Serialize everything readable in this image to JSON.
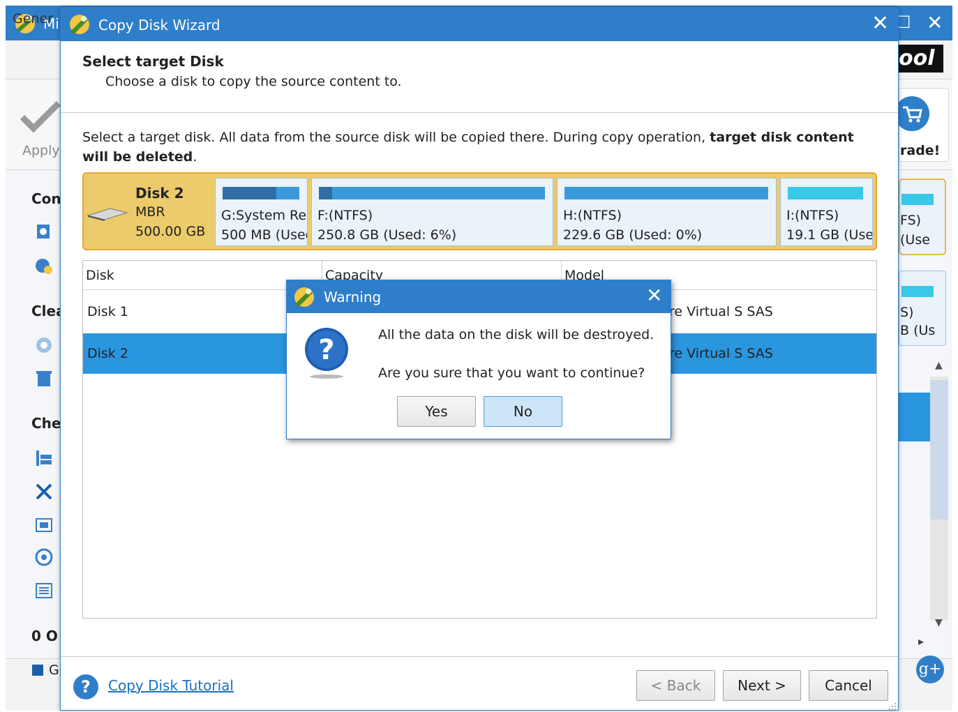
{
  "background": {
    "app_title": "Mi",
    "menu": {
      "general": "Gener"
    },
    "logo_fragment": "ool",
    "toolbar": {
      "apply": "Apply",
      "upgrade": "rade!"
    },
    "sidebar": {
      "heading1": "Con",
      "heading2": "Clea",
      "heading3": "Che"
    },
    "right_cards": [
      {
        "line1": "FS)",
        "line2": "(Use"
      },
      {
        "line1": "S)",
        "line2": "B (Us"
      }
    ],
    "ops_label": "0 O",
    "status_checkbox_label": "G"
  },
  "wizard": {
    "title": "Copy Disk Wizard",
    "heading": "Select target Disk",
    "subheading": "Choose a disk to copy the source content to.",
    "instructions_prefix": "Select a target disk. All data from the source disk will be copied there. During copy operation, ",
    "instructions_bold": "target disk content will be deleted",
    "instructions_suffix": ".",
    "disk_map": {
      "name": "Disk 2",
      "type": "MBR",
      "size": "500.00 GB",
      "partitions": [
        {
          "name": "G:System Re",
          "info": "500 MB (Used",
          "used_pct": 70
        },
        {
          "name": "F:(NTFS)",
          "info": "250.8 GB (Used: 6%)",
          "used_pct": 6
        },
        {
          "name": "H:(NTFS)",
          "info": "229.6 GB (Used: 0%)",
          "used_pct": 0
        },
        {
          "name": "I:(NTFS)",
          "info": "19.1 GB (Use",
          "used_pct": 0
        }
      ]
    },
    "table": {
      "columns": [
        "Disk",
        "Capacity",
        "Model"
      ],
      "rows": [
        {
          "disk": "Disk 1",
          "model": "re Virtual S SAS",
          "selected": false
        },
        {
          "disk": "Disk 2",
          "model": "re Virtual S SAS",
          "selected": true
        }
      ]
    },
    "tutorial_link": "Copy Disk Tutorial",
    "buttons": {
      "back": "< Back",
      "next": "Next >",
      "cancel": "Cancel"
    }
  },
  "warning": {
    "title": "Warning",
    "message1": "All the data on the disk will be destroyed.",
    "message2": "Are you sure that you want to continue?",
    "yes": "Yes",
    "no": "No"
  },
  "colors": {
    "titlebar": "#2f7ec9",
    "selection": "#2a96e0",
    "diskmap_bg": "#eccb6c",
    "partition_bar": "#3a9ad9"
  }
}
